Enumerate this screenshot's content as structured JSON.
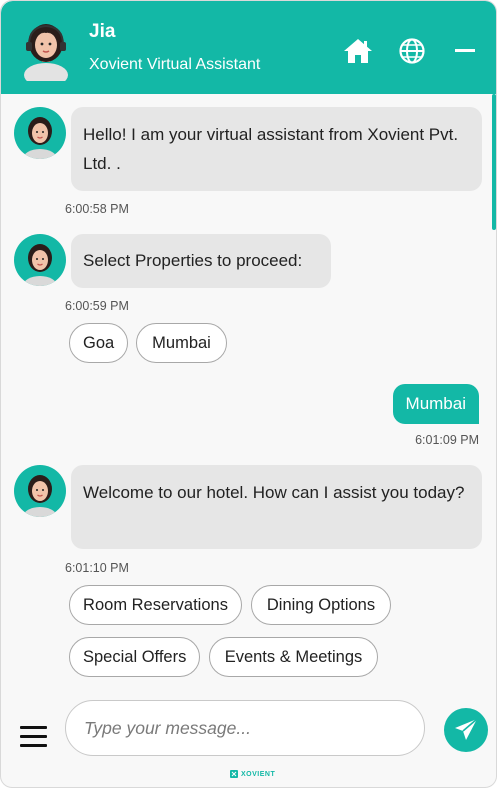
{
  "header": {
    "agent_name": "Jia",
    "subtitle": "Xovient Virtual Assistant"
  },
  "colors": {
    "accent": "#13b8a6",
    "bot_bubble": "#e6e6e6",
    "background": "#f8f8f8"
  },
  "messages": {
    "welcome": {
      "text": "Hello! I am your virtual assistant from Xovient Pvt. Ltd. .",
      "time": "6:00:58 PM"
    },
    "select_property": {
      "text": "Select Properties to proceed:",
      "time": "6:00:59 PM",
      "options": [
        "Goa",
        "Mumbai"
      ]
    },
    "user_reply": {
      "text": "Mumbai",
      "time": "6:01:09 PM"
    },
    "assist": {
      "text": "Welcome to our hotel. How can I assist you today?",
      "time": "6:01:10 PM",
      "options": [
        "Room Reservations",
        "Dining Options",
        "Special Offers",
        "Events & Meetings"
      ]
    }
  },
  "composer": {
    "placeholder": "Type your message..."
  },
  "footer": {
    "brand": "XOVIENT"
  },
  "icons": [
    "home-icon",
    "globe-icon",
    "minimize-icon",
    "menu-icon",
    "send-icon",
    "agent-avatar"
  ]
}
